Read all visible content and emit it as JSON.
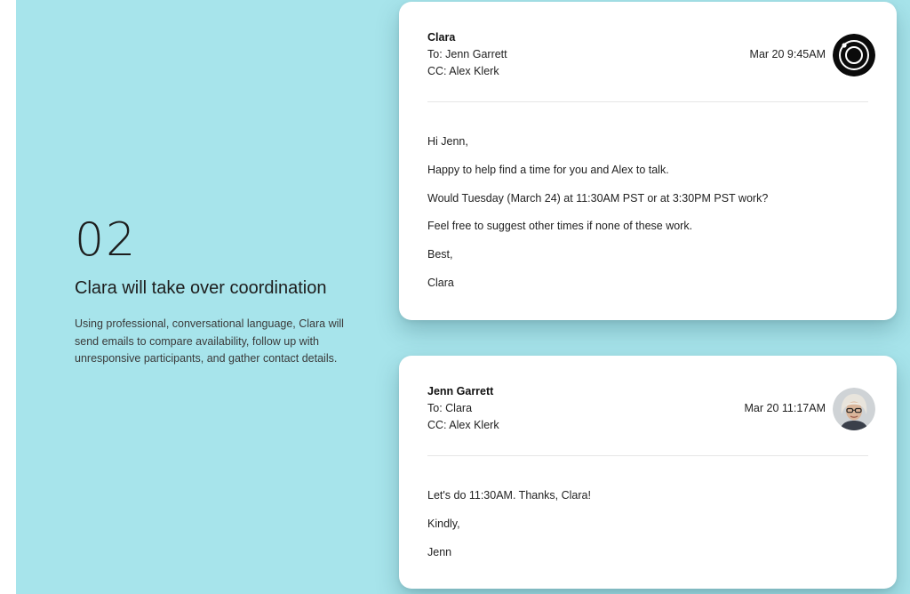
{
  "step": {
    "number": "02",
    "title": "Clara will take over coordination",
    "description": "Using professional, conversational language, Clara will send emails to compare availability, follow up with unresponsive participants, and gather contact details."
  },
  "emails": [
    {
      "sender": "Clara",
      "to": "To: Jenn Garrett",
      "cc": "CC: Alex Klerk",
      "timestamp": "Mar 20 9:45AM",
      "avatar_icon": "clara-logo-icon",
      "body": [
        "Hi Jenn,",
        "Happy to help find a time for you and Alex to talk.",
        "Would Tuesday (March 24) at 11:30AM PST or at 3:30PM PST work?",
        "Feel free to suggest other times if none of these work.",
        "Best,",
        "Clara"
      ]
    },
    {
      "sender": "Jenn Garrett",
      "to": "To: Clara",
      "cc": "CC: Alex Klerk",
      "timestamp": "Mar 20 11:17AM",
      "avatar_icon": "user-photo-avatar",
      "body": [
        "Let's do 11:30AM. Thanks, Clara!",
        "Kindly,",
        "Jenn"
      ]
    }
  ],
  "colors": {
    "panel_background": "#a7e4eb",
    "card_background": "#ffffff",
    "text": "#1f1f1f"
  }
}
